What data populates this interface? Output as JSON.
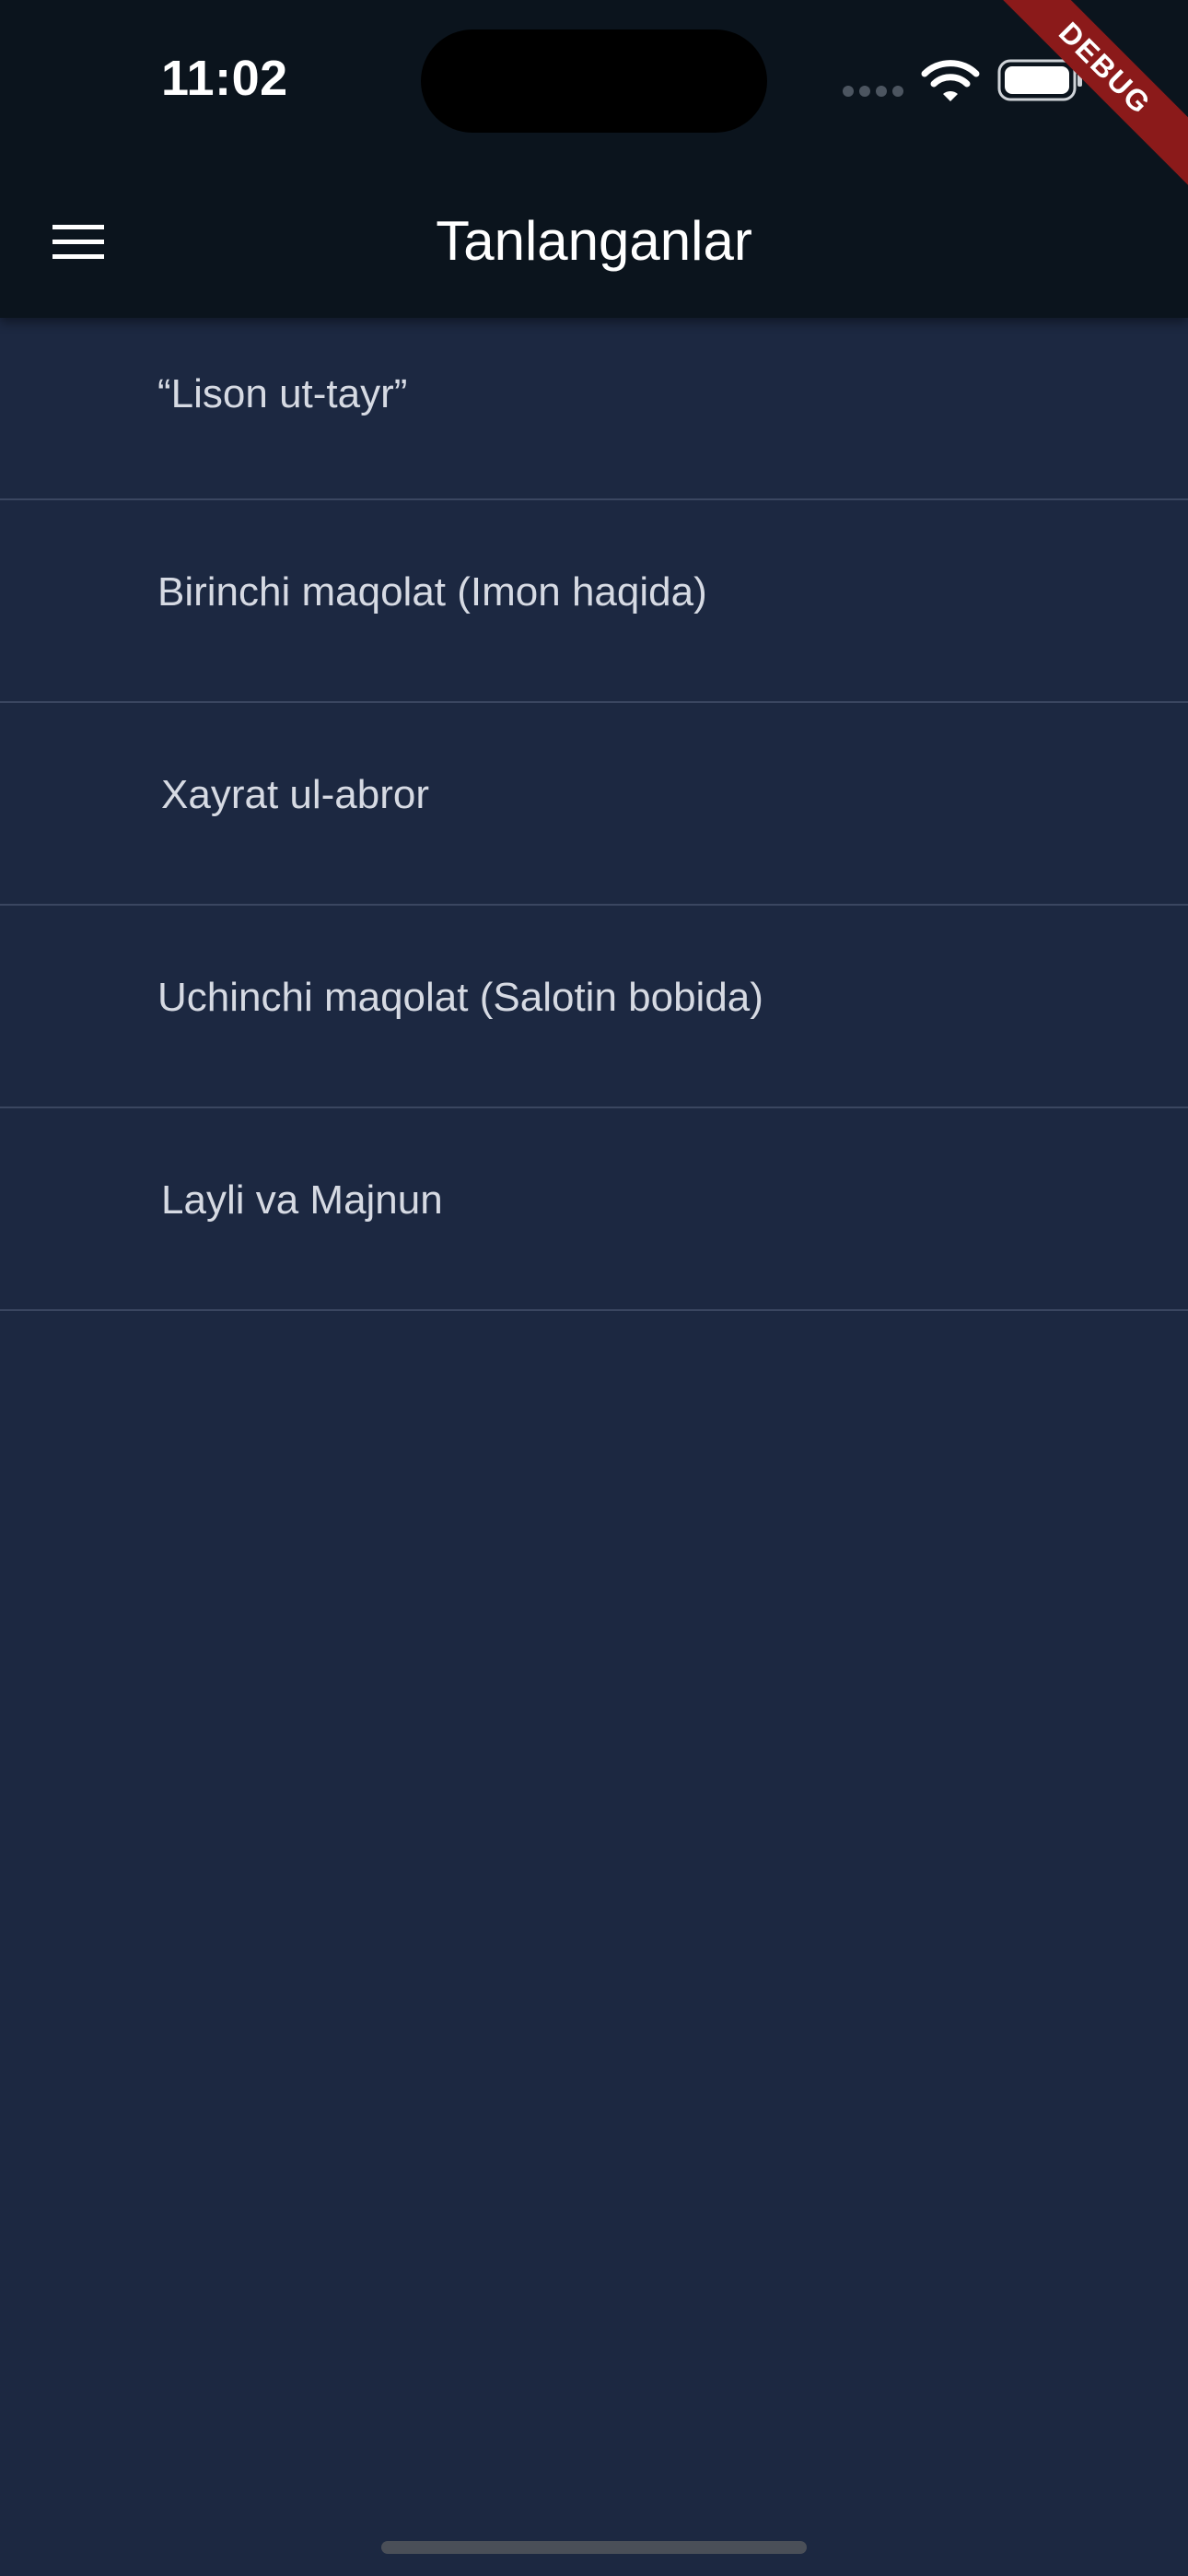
{
  "status_bar": {
    "time": "11:02",
    "icons": [
      "signal-icon",
      "wifi-icon",
      "battery-icon"
    ]
  },
  "app_bar": {
    "menu_icon": "hamburger-menu-icon",
    "title": "Tanlanganlar"
  },
  "debug_banner": "DEBUG",
  "favorites": [
    {
      "label": "“Lison ut-tayr”"
    },
    {
      "label": "Birinchi maqolat (Imon haqida)"
    },
    {
      "label": "Xayrat ul-abror"
    },
    {
      "label": "Uchinchi maqolat (Salotin bobida)"
    },
    {
      "label": "Layli va Majnun"
    }
  ],
  "colors": {
    "app_bar_bg": "#0b141d",
    "body_bg": "#1c2841",
    "divider": "#3a4660",
    "text": "#d6dae3",
    "debug_ribbon": "#8b1a1a"
  }
}
